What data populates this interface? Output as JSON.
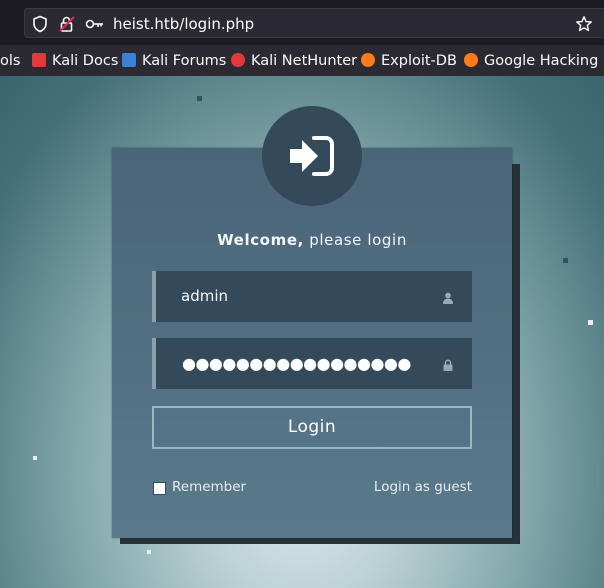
{
  "browser": {
    "url": "heist.htb/login.php",
    "icons": [
      "shield-icon",
      "padlock-warning-icon",
      "key-icon",
      "star-icon"
    ]
  },
  "bookmarks": [
    {
      "label": "ols",
      "icon": "none"
    },
    {
      "label": "Kali Docs",
      "icon": "kali-docs-icon",
      "color": "#e03a3a"
    },
    {
      "label": "Kali Forums",
      "icon": "kali-forums-icon",
      "color": "#3b82d6"
    },
    {
      "label": "Kali NetHunter",
      "icon": "kali-nethunter-icon",
      "color": "#e03a3a"
    },
    {
      "label": "Exploit-DB",
      "icon": "exploit-db-icon",
      "color": "#ff7a1a"
    },
    {
      "label": "Google Hacking DB",
      "icon": "ghdb-icon",
      "color": "#ff7a1a"
    }
  ],
  "login": {
    "welcome_bold": "Welcome,",
    "welcome_rest": " please login",
    "username_value": "admin",
    "password_masked": "●●●●●●●●●●●●●●●●●",
    "button_label": "Login",
    "remember_label": "Remember",
    "guest_link": "Login as guest",
    "remember_checked": false
  },
  "colors": {
    "card": "#4a6478",
    "field": "#34495a",
    "avatar": "#34495a",
    "accent_border": "#9fb6c0"
  }
}
